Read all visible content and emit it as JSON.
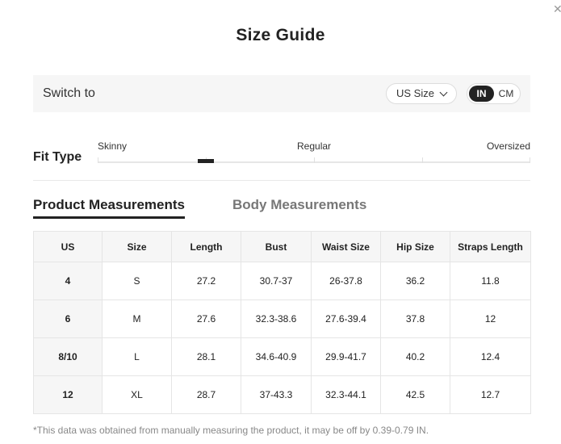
{
  "dialog": {
    "title": "Size Guide",
    "close_symbol": "✕"
  },
  "switch_bar": {
    "label": "Switch to",
    "size_select": {
      "selected": "US Size"
    },
    "units": {
      "in": "IN",
      "cm": "CM",
      "selected": "IN"
    }
  },
  "fit_type": {
    "label": "Fit Type",
    "scale": {
      "left": "Skinny",
      "middle": "Regular",
      "right": "Oversized"
    },
    "marker_position_fraction": 0.25
  },
  "tabs": {
    "product": "Product Measurements",
    "body": "Body Measurements",
    "active": "product"
  },
  "table": {
    "headers": [
      "US",
      "Size",
      "Length",
      "Bust",
      "Waist Size",
      "Hip Size",
      "Straps Length"
    ],
    "rows": [
      [
        "4",
        "S",
        "27.2",
        "30.7-37",
        "26-37.8",
        "36.2",
        "11.8"
      ],
      [
        "6",
        "M",
        "27.6",
        "32.3-38.6",
        "27.6-39.4",
        "37.8",
        "12"
      ],
      [
        "8/10",
        "L",
        "28.1",
        "34.6-40.9",
        "29.9-41.7",
        "40.2",
        "12.4"
      ],
      [
        "12",
        "XL",
        "28.7",
        "37-43.3",
        "32.3-44.1",
        "42.5",
        "12.7"
      ]
    ]
  },
  "footnote": "*This data was obtained from manually measuring the product, it may be off by 0.39-0.79 IN."
}
